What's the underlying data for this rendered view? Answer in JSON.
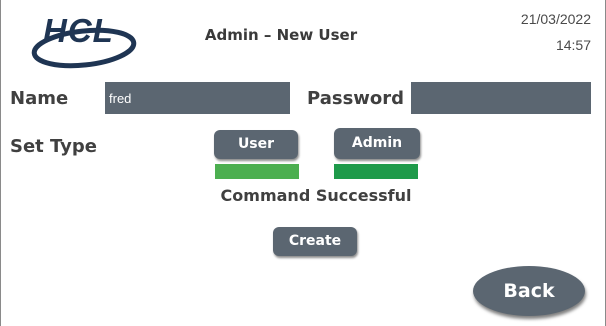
{
  "header": {
    "logo_text": "HCL",
    "title": "Admin – New User",
    "date": "21/03/2022",
    "time": "14:57"
  },
  "form": {
    "name_label": "Name",
    "name_value": "fred",
    "password_label": "Password",
    "password_value": "",
    "set_type_label": "Set Type"
  },
  "type_buttons": {
    "user_label": "User",
    "admin_label": "Admin",
    "user_indicator_color": "#4caf50",
    "admin_indicator_color": "#1e9a4a"
  },
  "status_text": "Command Successful",
  "create_label": "Create",
  "back_label": "Back",
  "colors": {
    "accent": "#5b6671",
    "text": "#404040"
  }
}
